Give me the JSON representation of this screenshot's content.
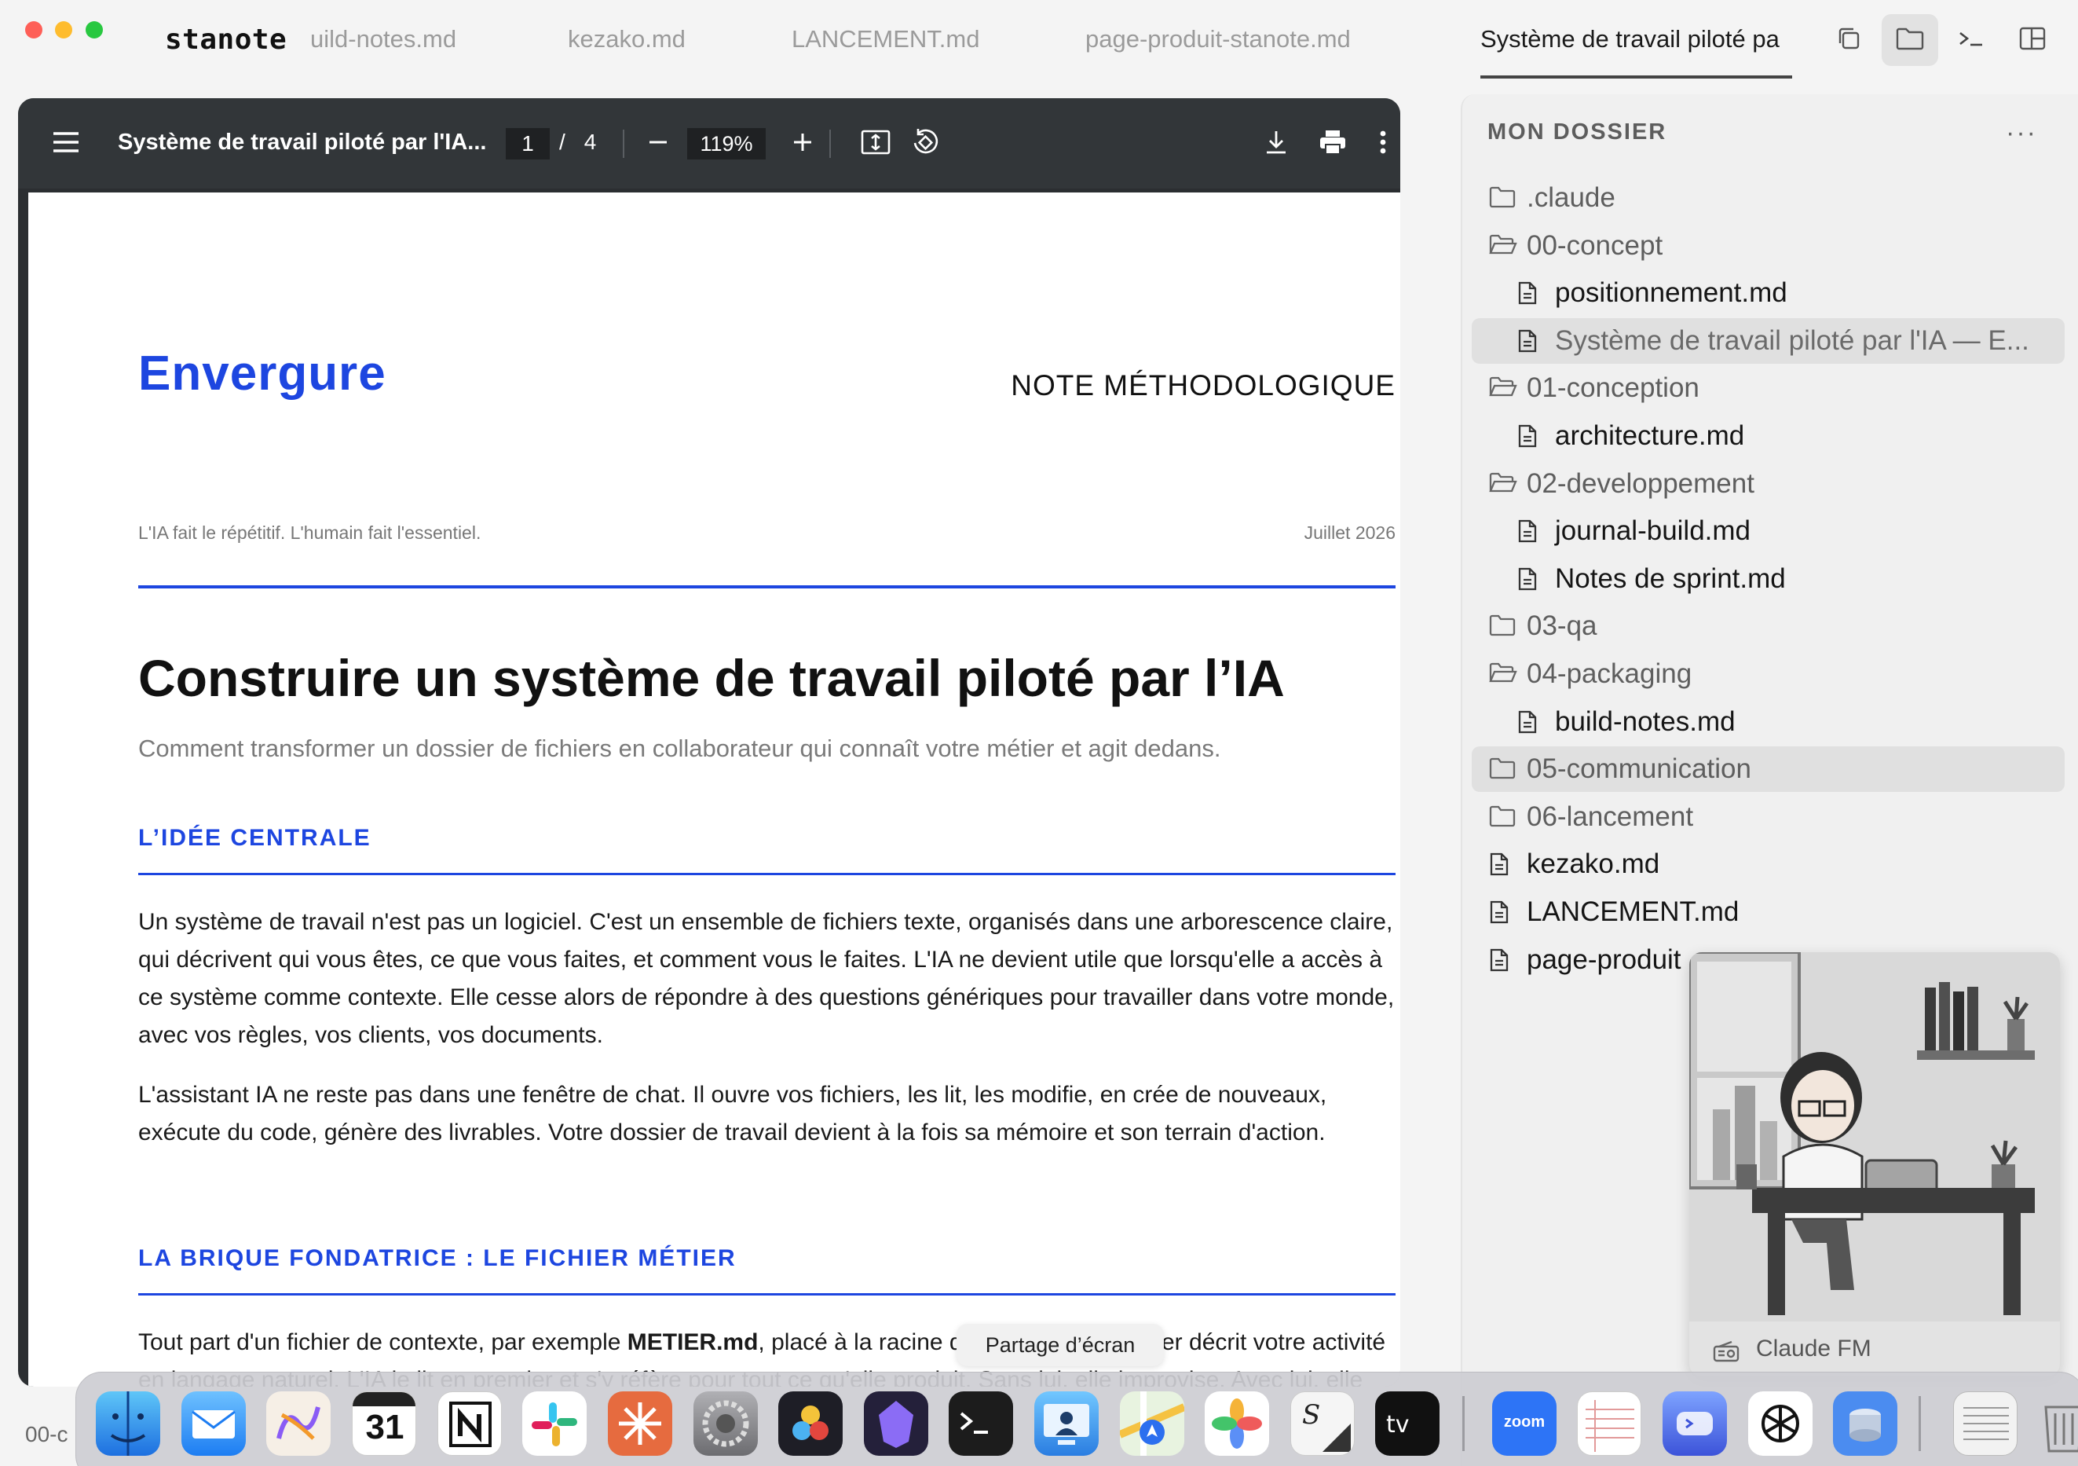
{
  "app": {
    "name": "stanote",
    "tabs": [
      {
        "label": "build-notes.md",
        "clipped_text": "uild-notes.md"
      },
      {
        "label": "kezako.md"
      },
      {
        "label": "LANCEMENT.md"
      },
      {
        "label": "page-produit-stanote.md"
      },
      {
        "label": "Système de travail piloté pa",
        "active": true
      }
    ],
    "toolbar_icons": [
      "copy-icon",
      "folder-icon",
      "terminal-icon",
      "split-layout-icon"
    ]
  },
  "pdf": {
    "title": "Système de travail piloté par l'IA...",
    "page_current": "1",
    "page_separator": "/",
    "page_total": "4",
    "zoom": "119%"
  },
  "document": {
    "brand": "Envergure",
    "kind": "NOTE MÉTHODOLOGIQUE",
    "tagline": "L'IA fait le répétitif. L'humain fait l'essentiel.",
    "date": "Juillet 2026",
    "title": "Construire un système de travail piloté par l’IA",
    "lead": "Comment transformer un dossier de fichiers en collaborateur qui connaît votre métier et agit dedans.",
    "section1": {
      "heading": "L’IDÉE CENTRALE",
      "p1": "Un système de travail n'est pas un logiciel. C'est un ensemble de fichiers texte, organisés dans une arborescence claire, qui décrivent qui vous êtes, ce que vous faites, et comment vous le faites. L'IA ne devient utile que lorsqu'elle a accès à ce système comme contexte. Elle cesse alors de répondre à des questions génériques pour travailler dans votre monde, avec vos règles, vos clients, vos documents.",
      "p2": "L'assistant IA ne reste pas dans une fenêtre de chat. Il ouvre vos fichiers, les lit, les modifie, en crée de nouveaux, exécute du code, génère des livrables. Votre dossier de travail devient à la fois sa mémoire et son terrain d'action."
    },
    "section2": {
      "heading": "LA BRIQUE FONDATRICE : LE FICHIER MÉTIER",
      "p1_before": "Tout part d'un fichier de contexte, par exemple ",
      "p1_bold": "METIER.md",
      "p1_after": ", placé à la racine du système. Ce fichier décrit votre activité en langage naturel. L'IA le lit en premier et s'y réfère pour tout ce qu'elle produit. Sans lui, elle improvise. Avec lui, elle applique votre cadre."
    }
  },
  "sidebar": {
    "heading": "MON DOSSIER",
    "more": "···",
    "items": [
      {
        "label": ".claude",
        "type": "folder",
        "open": false,
        "depth": 0
      },
      {
        "label": "00-concept",
        "type": "folder",
        "open": true,
        "depth": 0
      },
      {
        "label": "positionnement.md",
        "type": "file",
        "depth": 1
      },
      {
        "label": "Système de travail piloté par l'IA — E...",
        "type": "file",
        "depth": 1,
        "selected": true
      },
      {
        "label": "01-conception",
        "type": "folder",
        "open": true,
        "depth": 0
      },
      {
        "label": "architecture.md",
        "type": "file",
        "depth": 1
      },
      {
        "label": "02-developpement",
        "type": "folder",
        "open": true,
        "depth": 0
      },
      {
        "label": "journal-build.md",
        "type": "file",
        "depth": 1
      },
      {
        "label": "Notes de sprint.md",
        "type": "file",
        "depth": 1
      },
      {
        "label": "03-qa",
        "type": "folder",
        "open": false,
        "depth": 0
      },
      {
        "label": "04-packaging",
        "type": "folder",
        "open": true,
        "depth": 0
      },
      {
        "label": "build-notes.md",
        "type": "file",
        "depth": 1
      },
      {
        "label": "05-communication",
        "type": "folder",
        "open": false,
        "depth": 0,
        "hover": true
      },
      {
        "label": "06-lancement",
        "type": "folder",
        "open": false,
        "depth": 0
      },
      {
        "label": "kezako.md",
        "type": "file",
        "depth": 0
      },
      {
        "label": "LANCEMENT.md",
        "type": "file",
        "depth": 0
      },
      {
        "label": "page-produit",
        "type": "file",
        "depth": 0
      }
    ]
  },
  "camera": {
    "label": "Claude FM",
    "icon": "radio-icon"
  },
  "dock": {
    "tooltip": "Partage d’écran",
    "behind_text": "00-c",
    "apps": [
      "finder",
      "mail",
      "freeform",
      "calendar",
      "notion",
      "slack",
      "claude",
      "system-settings",
      "davinci-resolve",
      "obsidian",
      "terminal",
      "screen-sharing",
      "maps",
      "photos",
      "script-editor",
      "apple-tv",
      "zoom",
      "textedit",
      "warp",
      "chatgpt",
      "disk-utility",
      "notes-stack",
      "trash"
    ],
    "calendar_day": "31",
    "zoom_label": "zoom"
  },
  "colors": {
    "accent_blue": "#1d46e0",
    "pdf_toolbar": "#323639",
    "sidebar_bg": "#f0f0f0",
    "traffic_red": "#fe5f57",
    "traffic_yellow": "#febc2e",
    "traffic_green": "#28c840"
  }
}
